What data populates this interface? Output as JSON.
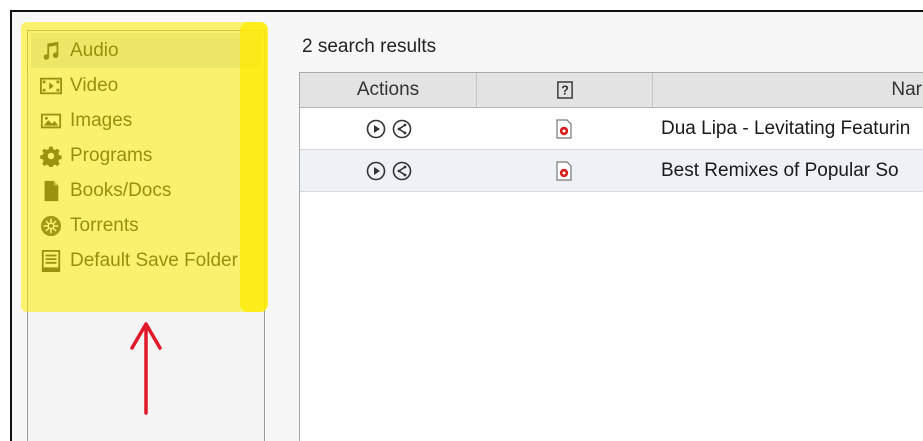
{
  "sidebar": {
    "items": [
      {
        "label": "Audio",
        "icon": "music-note-icon",
        "selected": true
      },
      {
        "label": "Video",
        "icon": "film-icon"
      },
      {
        "label": "Images",
        "icon": "image-icon"
      },
      {
        "label": "Programs",
        "icon": "gear-icon"
      },
      {
        "label": "Books/Docs",
        "icon": "document-icon"
      },
      {
        "label": "Torrents",
        "icon": "torrent-icon"
      },
      {
        "label": "Default Save Folder",
        "icon": "save-folder-icon"
      }
    ]
  },
  "results": {
    "count_label": "2 search results",
    "columns": [
      "Actions",
      "?",
      "Nar"
    ],
    "rows": [
      {
        "name": "Dua Lipa - Levitating Featurin"
      },
      {
        "name": "Best Remixes of Popular So"
      }
    ]
  },
  "colors": {
    "highlight": "#fff000",
    "arrow": "#e0182a",
    "selected_row": "#d6dbe2"
  }
}
